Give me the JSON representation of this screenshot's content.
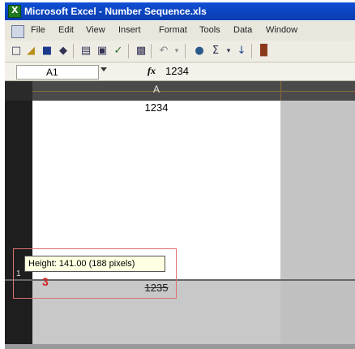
{
  "window": {
    "title": "Microsoft Excel - Number Sequence.xls"
  },
  "menu": [
    "File",
    "Edit",
    "View",
    "Insert",
    "Format",
    "Tools",
    "Data",
    "Window"
  ],
  "toolbar_icons": [
    "new-icon",
    "open-icon",
    "save-icon",
    "permission-icon",
    "print-icon",
    "print-preview-icon",
    "spelling-icon",
    "research-icon",
    "undo-icon",
    "undo-dropdown-icon",
    "hyperlink-icon",
    "autosum-icon",
    "autosum-dropdown-icon",
    "sort-ascending-icon",
    "chart-wizard-icon"
  ],
  "formula_bar": {
    "name_box": "A1",
    "fx_label": "fx",
    "content": "1234"
  },
  "sheet": {
    "column_header": "A",
    "row_number": "1",
    "cells": {
      "a1": "1234",
      "a2": "1235"
    }
  },
  "tooltip": "Height: 141.00 (188 pixels)",
  "callout": {
    "number": "3",
    "color": "#d42020"
  },
  "colors": {
    "title_bar": "#0a3cb0",
    "accent": "#d42020"
  }
}
